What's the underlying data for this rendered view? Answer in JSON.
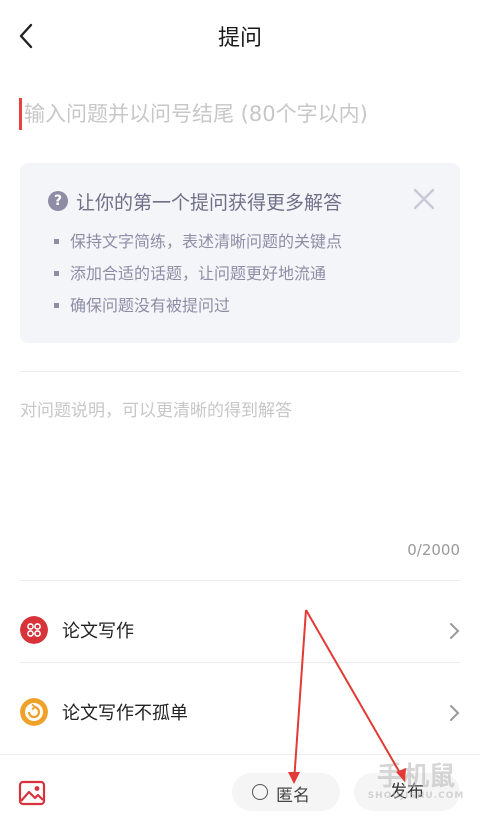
{
  "header": {
    "title": "提问",
    "back_icon": "chevron-left-icon"
  },
  "question": {
    "placeholder": "输入问题并以问号结尾 (80个字以内)",
    "value": ""
  },
  "tips": {
    "title": "让你的第一个提问获得更多解答",
    "items": [
      "保持文字简练，表述清晰问题的关键点",
      "添加合适的话题，让问题更好地流通",
      "确保问题没有被提问过"
    ],
    "icon": "question-circle-icon",
    "close_icon": "close-icon"
  },
  "description": {
    "placeholder": "对问题说明，可以更清晰的得到解答",
    "value": "",
    "counter": "0/2000"
  },
  "topics": [
    {
      "label": "论文写作",
      "icon": "grid-circle-icon",
      "color": "#d8323a"
    },
    {
      "label": "论文写作不孤单",
      "icon": "refresh-circle-icon",
      "color": "#f0a12a"
    }
  ],
  "bottom_bar": {
    "image_icon": "image-icon",
    "anonymous_label": "匿名",
    "publish_label": "发布"
  },
  "watermark": {
    "text": "手机鼠",
    "sub": "SHOUJISHU.COM"
  },
  "colors": {
    "accent": "#e7423f",
    "tips_bg": "#f4f5f9",
    "tips_text": "#8d8ea5"
  }
}
